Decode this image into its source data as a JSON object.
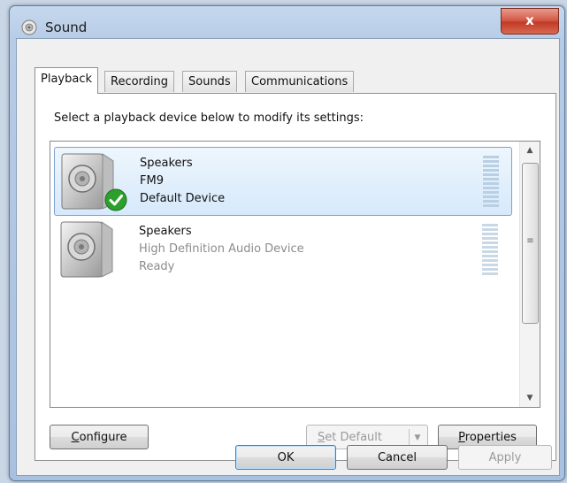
{
  "window": {
    "title": "Sound",
    "close_glyph": "x"
  },
  "tabs": [
    {
      "label": "Playback",
      "active": true
    },
    {
      "label": "Recording",
      "active": false
    },
    {
      "label": "Sounds",
      "active": false
    },
    {
      "label": "Communications",
      "active": false
    }
  ],
  "playback": {
    "instruction": "Select a playback device below to modify its settings:",
    "devices": [
      {
        "name": "Speakers",
        "detail": "FM9",
        "status": "Default Device",
        "selected": true,
        "is_default": true,
        "icon": "speaker-icon"
      },
      {
        "name": "Speakers",
        "detail": "High Definition Audio Device",
        "status": "Ready",
        "selected": false,
        "is_default": false,
        "icon": "speaker-icon"
      }
    ],
    "buttons": {
      "configure": {
        "prefix": "",
        "underline": "C",
        "rest": "onfigure"
      },
      "set_default": {
        "prefix": "",
        "underline": "S",
        "rest": "et Default",
        "disabled": true
      },
      "properties": {
        "prefix": "",
        "underline": "P",
        "rest": "roperties"
      }
    }
  },
  "footer": {
    "ok": "OK",
    "cancel": "Cancel",
    "apply": "Apply"
  },
  "icons": {
    "title": "sound-icon",
    "default_check": "checkmark-icon",
    "scroll_up": "▲",
    "scroll_down": "▼",
    "dropdown": "▼"
  },
  "colors": {
    "check_green": "#2ca02c",
    "selection": "#d6e9fb",
    "close_red": "#c94a35"
  }
}
